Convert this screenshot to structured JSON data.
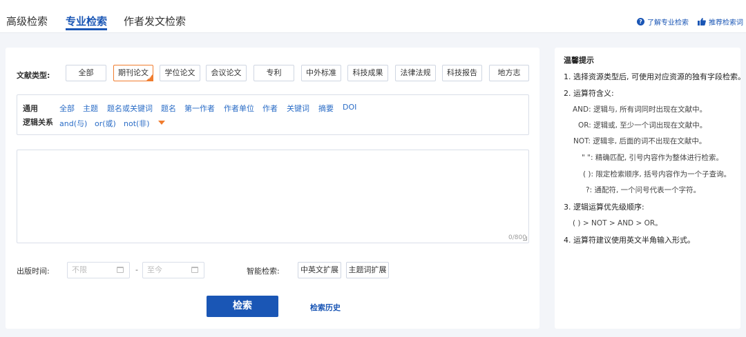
{
  "tabs": [
    {
      "label": "高级检索",
      "active": false
    },
    {
      "label": "专业检索",
      "active": true
    },
    {
      "label": "作者发文检索",
      "active": false
    }
  ],
  "top_links": {
    "learn": "了解专业检索",
    "recommend": "推荐检索词"
  },
  "doc_type": {
    "label": "文献类型:",
    "options": [
      "全部",
      "期刊论文",
      "学位论文",
      "会议论文",
      "专利",
      "中外标准",
      "科技成果",
      "法律法规",
      "科技报告",
      "地方志"
    ],
    "selected": "期刊论文"
  },
  "fields": {
    "general_label": "通用",
    "logic_label": "逻辑关系",
    "field_links": [
      "全部",
      "主题",
      "题名或关键词",
      "题名",
      "第一作者",
      "作者单位",
      "作者",
      "关键词",
      "摘要",
      "DOI"
    ],
    "logic_links": [
      "and(与)",
      "or(或)",
      "not(非)"
    ]
  },
  "query": {
    "value": "",
    "counter": "0/800"
  },
  "publish_time": {
    "label": "出版时间:",
    "from_placeholder": "不限",
    "separator": "-",
    "to_placeholder": "至今"
  },
  "smart_search": {
    "label": "智能检索:",
    "options": [
      "中英文扩展",
      "主题词扩展"
    ]
  },
  "actions": {
    "search": "检索",
    "history": "检索历史"
  },
  "tips": {
    "title": "温馨提示",
    "item1": "1. 选择资源类型后, 可使用对应资源的独有字段检索。",
    "item2": "2. 运算符含义:",
    "and": "AND: 逻辑与, 所有词同时出现在文献中。",
    "or": "OR: 逻辑或, 至少一个词出现在文献中。",
    "not": "NOT: 逻辑非, 后面的词不出现在文献中。",
    "quote": "\" \": 精确匹配, 引号内容作为整体进行检索。",
    "paren": "( ): 限定检索顺序, 括号内容作为一个子查询。",
    "wildcard": "?: 通配符, 一个问号代表一个字符。",
    "item3": "3. 逻辑运算优先级顺序:",
    "order": "( ) > NOT > AND > OR。",
    "item4": "4. 运算符建议使用英文半角输入形式。"
  },
  "colors": {
    "accent": "#1a56b5",
    "link": "#2a6cc6",
    "highlight": "#f07c2e"
  }
}
